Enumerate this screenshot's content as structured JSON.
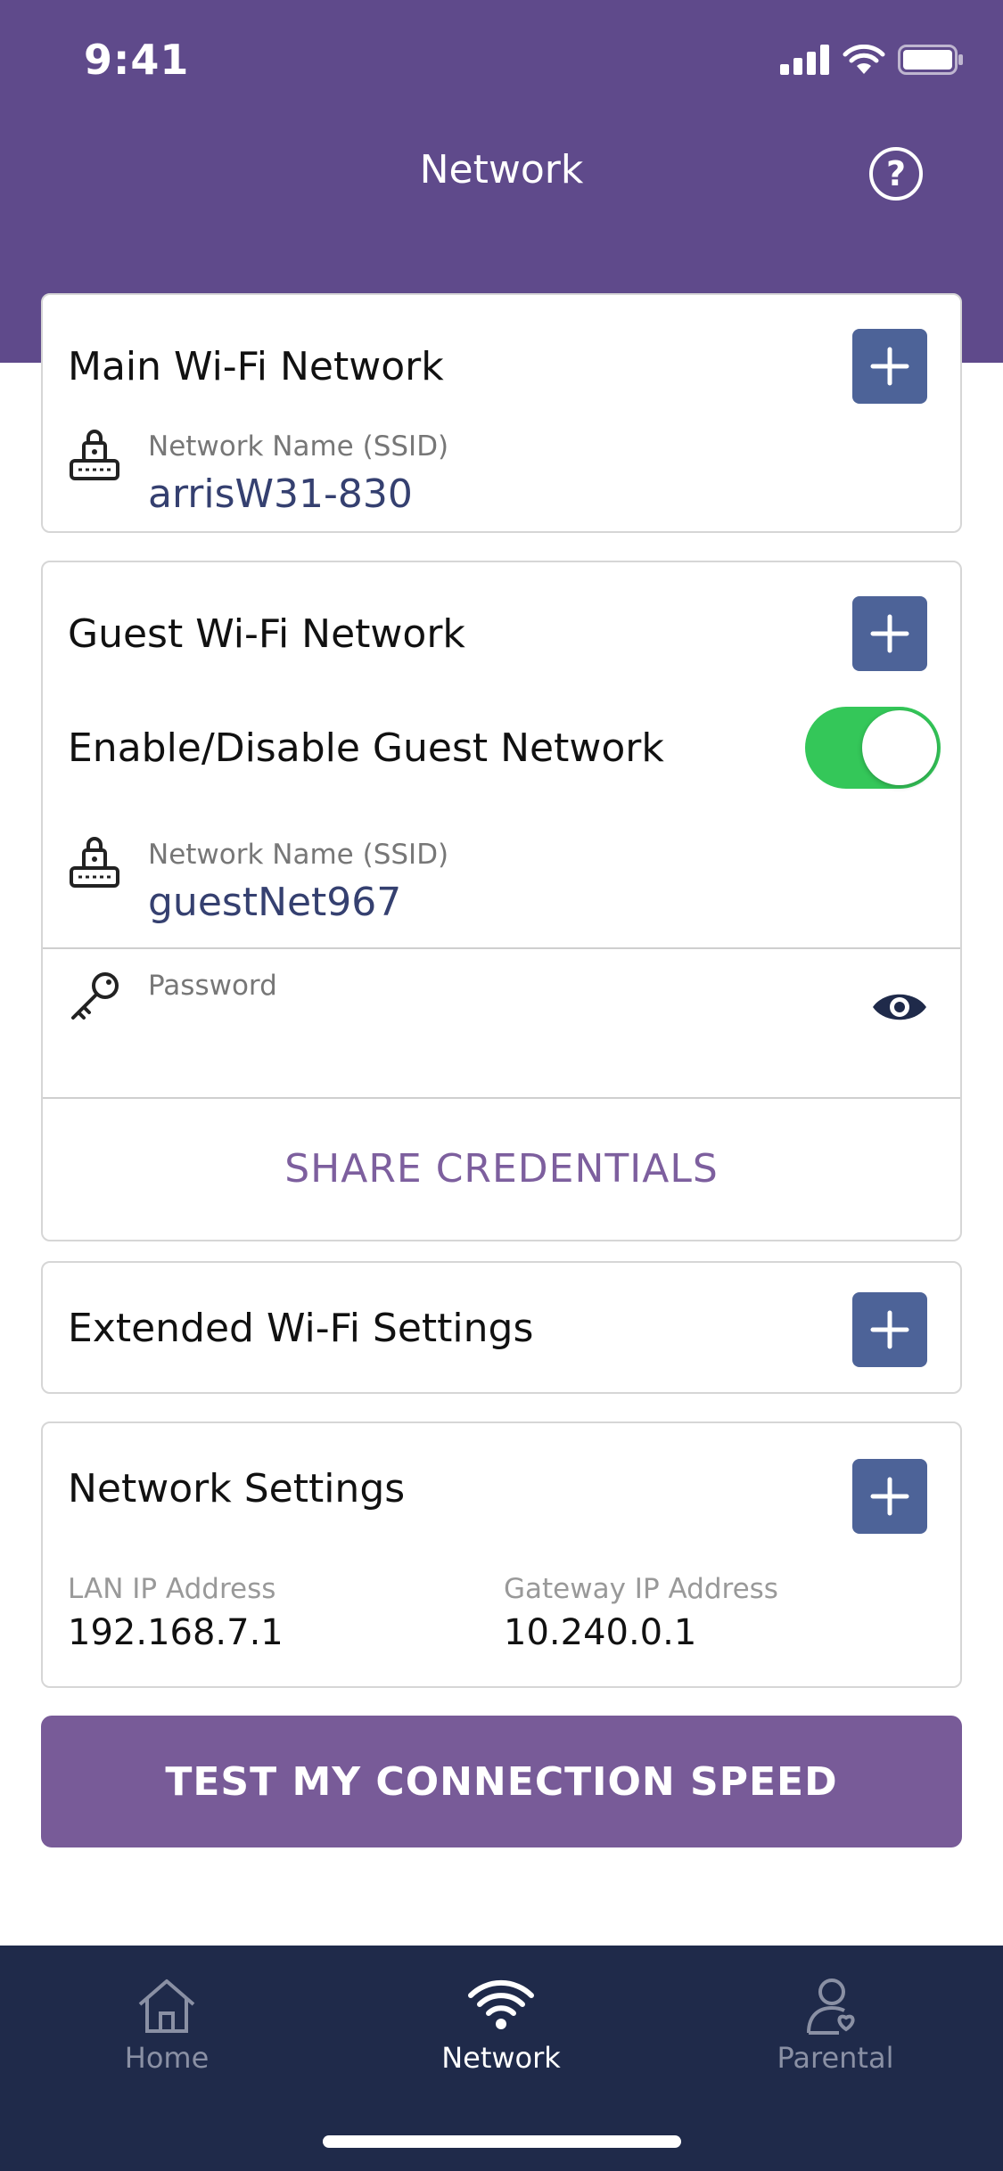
{
  "status_bar": {
    "time": "9:41"
  },
  "header": {
    "title": "Network",
    "help_icon": "question-circle-icon"
  },
  "main_wifi": {
    "title": "Main Wi-Fi Network",
    "ssid_label": "Network Name (SSID)",
    "ssid_value": "arrisW31-830"
  },
  "guest_wifi": {
    "title": "Guest Wi-Fi Network",
    "toggle_label": "Enable/Disable Guest Network",
    "toggle_on": true,
    "ssid_label": "Network Name (SSID)",
    "ssid_value": "guestNet967",
    "password_label": "Password",
    "share_label": "SHARE CREDENTIALS"
  },
  "extended": {
    "title": "Extended Wi-Fi Settings"
  },
  "network_settings": {
    "title": "Network Settings",
    "lan_label": "LAN IP Address",
    "lan_value": "192.168.7.1",
    "gateway_label": "Gateway IP Address",
    "gateway_value": "10.240.0.1"
  },
  "speed_test": {
    "label": "TEST MY CONNECTION SPEED"
  },
  "tabs": [
    {
      "label": "Home",
      "icon": "home-icon",
      "active": false
    },
    {
      "label": "Network",
      "icon": "wifi-icon",
      "active": true
    },
    {
      "label": "Parental",
      "icon": "parental-icon",
      "active": false
    }
  ],
  "colors": {
    "header": "#5f4a8b",
    "accent_button": "#4d6398",
    "toggle_on": "#34c759",
    "speed_button": "#785b98",
    "tabbar": "#1f2a4a"
  }
}
